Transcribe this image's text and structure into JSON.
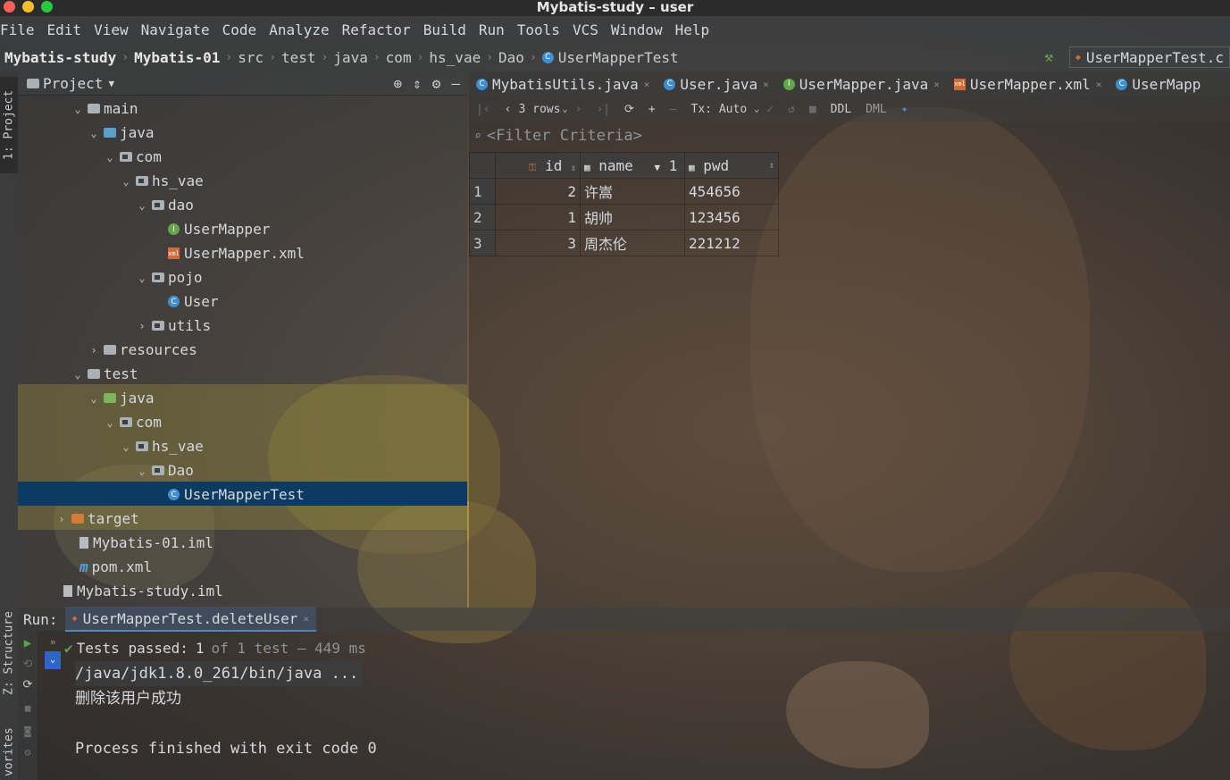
{
  "window": {
    "title": "Mybatis-study – user"
  },
  "colors": {
    "close": "#ff5f57",
    "minimize": "#ffbd2e",
    "maximize": "#28c940",
    "selection": "#0d3a61"
  },
  "menu": [
    "File",
    "Edit",
    "View",
    "Navigate",
    "Code",
    "Analyze",
    "Refactor",
    "Build",
    "Run",
    "Tools",
    "VCS",
    "Window",
    "Help"
  ],
  "breadcrumbs": [
    "Mybatis-study",
    "Mybatis-01",
    "src",
    "test",
    "java",
    "com",
    "hs_vae",
    "Dao",
    "UserMapperTest"
  ],
  "run_config": "UserMapperTest.c",
  "side_tabs": {
    "project": "1: Project",
    "structure": "Z: Structure",
    "favorites": "vorites"
  },
  "project": {
    "header": "Project",
    "tree": [
      {
        "label": "main",
        "indent": 0,
        "icon": "folder",
        "expanded": true
      },
      {
        "label": "java",
        "indent": 1,
        "icon": "folder-src",
        "expanded": true
      },
      {
        "label": "com",
        "indent": 2,
        "icon": "package",
        "expanded": true
      },
      {
        "label": "hs_vae",
        "indent": 3,
        "icon": "package",
        "expanded": true
      },
      {
        "label": "dao",
        "indent": 4,
        "icon": "package",
        "expanded": true
      },
      {
        "label": "UserMapper",
        "indent": 5,
        "icon": "interface"
      },
      {
        "label": "UserMapper.xml",
        "indent": 5,
        "icon": "xml"
      },
      {
        "label": "pojo",
        "indent": 4,
        "icon": "package",
        "expanded": true
      },
      {
        "label": "User",
        "indent": 5,
        "icon": "class"
      },
      {
        "label": "utils",
        "indent": 4,
        "icon": "package",
        "expanded": false
      },
      {
        "label": "resources",
        "indent": 1,
        "icon": "folder",
        "expanded": false
      },
      {
        "label": "test",
        "indent": 0,
        "icon": "folder",
        "expanded": true
      },
      {
        "label": "java",
        "indent": 1,
        "icon": "folder-test",
        "expanded": true
      },
      {
        "label": "com",
        "indent": 2,
        "icon": "package",
        "expanded": true
      },
      {
        "label": "hs_vae",
        "indent": 3,
        "icon": "package",
        "expanded": true
      },
      {
        "label": "Dao",
        "indent": 4,
        "icon": "package",
        "expanded": true
      },
      {
        "label": "UserMapperTest",
        "indent": 5,
        "icon": "class-test",
        "selected": true
      },
      {
        "label": "target",
        "indent": -1,
        "icon": "folder-orange",
        "expanded": false
      },
      {
        "label": "Mybatis-01.iml",
        "indent": -0.5,
        "icon": "file"
      },
      {
        "label": "pom.xml",
        "indent": -0.5,
        "icon": "maven"
      },
      {
        "label": "Mybatis-study.iml",
        "indent": -1.5,
        "icon": "file"
      }
    ]
  },
  "editor": {
    "tabs": [
      "MybatisUtils.java",
      "User.java",
      "UserMapper.java",
      "UserMapper.xml",
      "UserMapp"
    ],
    "db_toolbar": {
      "rows": "3 rows",
      "tx": "Tx: Auto",
      "ddl": "DDL",
      "dml": "DML"
    },
    "filter_placeholder": "<Filter Criteria>",
    "table": {
      "columns": [
        "id",
        "name",
        "pwd"
      ],
      "sort_indicator": "1",
      "rows": [
        {
          "num": "1",
          "id": "2",
          "name": "许嵩",
          "pwd": "454656"
        },
        {
          "num": "2",
          "id": "1",
          "name": "胡帅",
          "pwd": "123456"
        },
        {
          "num": "3",
          "id": "3",
          "name": "周杰伦",
          "pwd": "221212"
        }
      ]
    }
  },
  "run": {
    "label": "Run:",
    "tab": "UserMapperTest.deleteUser",
    "status_prefix": "Tests passed:",
    "status_count": "1",
    "status_suffix": "of 1 test — 449 ms",
    "console": [
      "/java/jdk1.8.0_261/bin/java ...",
      "删除该用户成功",
      "",
      "Process finished with exit code 0"
    ]
  }
}
